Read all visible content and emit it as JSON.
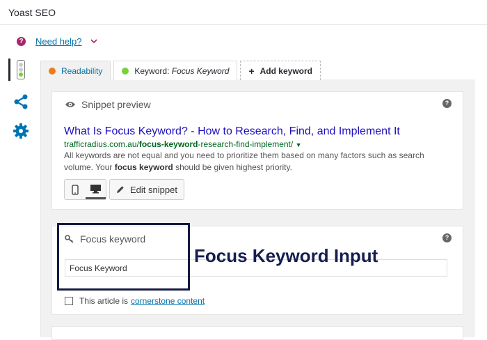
{
  "metabox": {
    "title": "Yoast SEO"
  },
  "help": {
    "icon": "help-circle-icon",
    "link_text": "Need help?",
    "chevron": "chevron-down-icon"
  },
  "sidebar": {
    "items": [
      {
        "name": "readability-analysis",
        "icon": "traffic-light-icon",
        "active": true
      },
      {
        "name": "social",
        "icon": "share-icon"
      },
      {
        "name": "advanced",
        "icon": "gear-icon"
      }
    ]
  },
  "tabs": [
    {
      "label": "Readability",
      "status_color": "#ee7c1b"
    },
    {
      "label_prefix": "Keyword: ",
      "label_italic": "Focus Keyword",
      "status_color": "#7ad03a",
      "active": true
    },
    {
      "label": "Add keyword",
      "icon": "plus-icon"
    }
  ],
  "snippet": {
    "heading": "Snippet preview",
    "title": "What Is Focus Keyword? - How to Research, Find, and Implement It",
    "url_prefix": "trafficradius.com.au/",
    "url_bold": "focus-keyword",
    "url_suffix": "-research-find-implement/",
    "desc_start": "All keywords are not equal and you need to prioritize them based on many factors such as search volume. Your ",
    "desc_bold": "focus keyword",
    "desc_end": " should be given highest priority.",
    "edit_label": "Edit snippet"
  },
  "focus": {
    "heading": "Focus keyword",
    "input_value": "Focus Keyword",
    "cornerstone_prefix": "This article is",
    "cornerstone_link": "cornerstone content"
  },
  "annotation": {
    "label": "Focus Keyword Input"
  },
  "colors": {
    "accent_link": "#0073aa",
    "brand_purple": "#a4286a",
    "annotation_navy": "#141a3f",
    "sidebar_icon": "#0075b3"
  }
}
